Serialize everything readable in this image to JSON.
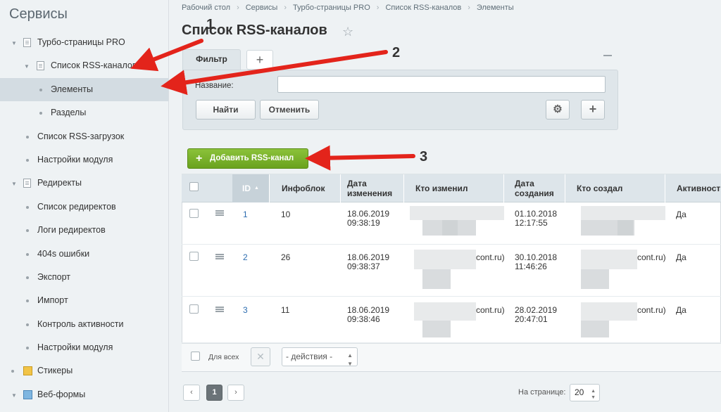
{
  "sidebar": {
    "title": "Сервисы",
    "items": [
      {
        "label": "Турбо-страницы PRO"
      },
      {
        "label": "Список RSS-каналов"
      },
      {
        "label": "Элементы"
      },
      {
        "label": "Разделы"
      },
      {
        "label": "Список RSS-загрузок"
      },
      {
        "label": "Настройки модуля"
      },
      {
        "label": "Редиректы"
      },
      {
        "label": "Список редиректов"
      },
      {
        "label": "Логи редиректов"
      },
      {
        "label": "404s ошибки"
      },
      {
        "label": "Экспорт"
      },
      {
        "label": "Импорт"
      },
      {
        "label": "Контроль активности"
      },
      {
        "label": "Настройки модуля"
      },
      {
        "label": "Стикеры"
      },
      {
        "label": "Веб-формы"
      }
    ]
  },
  "breadcrumb": [
    "Рабочий стол",
    "Сервисы",
    "Турбо-страницы PRO",
    "Список RSS-каналов",
    "Элементы"
  ],
  "page": {
    "title": "Список RSS-каналов"
  },
  "filter": {
    "tab_label": "Фильтр",
    "name_label": "Название:",
    "name_value": "",
    "find_label": "Найти",
    "cancel_label": "Отменить"
  },
  "toolbar": {
    "add_label": "Добавить RSS-канал"
  },
  "table": {
    "headers": {
      "id": "ID",
      "infoblock": "Инфоблок",
      "date_changed": [
        "Дата",
        "изменения"
      ],
      "changed_by": "Кто изменил",
      "date_created": [
        "Дата",
        "создания"
      ],
      "created_by": "Кто создал",
      "active": "Активност"
    },
    "rows": [
      {
        "id": "1",
        "infoblock": "10",
        "date_changed": [
          "18.06.2019",
          "09:38:19"
        ],
        "changed_by_suffix": "",
        "date_created": [
          "01.10.2018",
          "12:17:55"
        ],
        "created_by_suffix": "",
        "active": "Да"
      },
      {
        "id": "2",
        "infoblock": "26",
        "date_changed": [
          "18.06.2019",
          "09:38:37"
        ],
        "changed_by_suffix": "cont.ru)",
        "date_created": [
          "30.10.2018",
          "11:46:26"
        ],
        "created_by_suffix": "cont.ru)",
        "active": "Да"
      },
      {
        "id": "3",
        "infoblock": "11",
        "date_changed": [
          "18.06.2019",
          "09:38:46"
        ],
        "changed_by_suffix": "cont.ru)",
        "date_created": [
          "28.02.2019",
          "20:47:01"
        ],
        "created_by_suffix": "cont.ru)",
        "active": "Да"
      }
    ]
  },
  "footer": {
    "for_all": "Для всех",
    "actions": "- действия -"
  },
  "pagination": {
    "prev": "‹",
    "current": "1",
    "next": "›",
    "per_page_label": "На странице:",
    "per_page": "20"
  },
  "annotations": [
    "1",
    "2",
    "3"
  ],
  "colors": {
    "accent_green": "#7ab22c",
    "annotation_red": "#e3241b",
    "link_blue": "#2d6db0"
  }
}
